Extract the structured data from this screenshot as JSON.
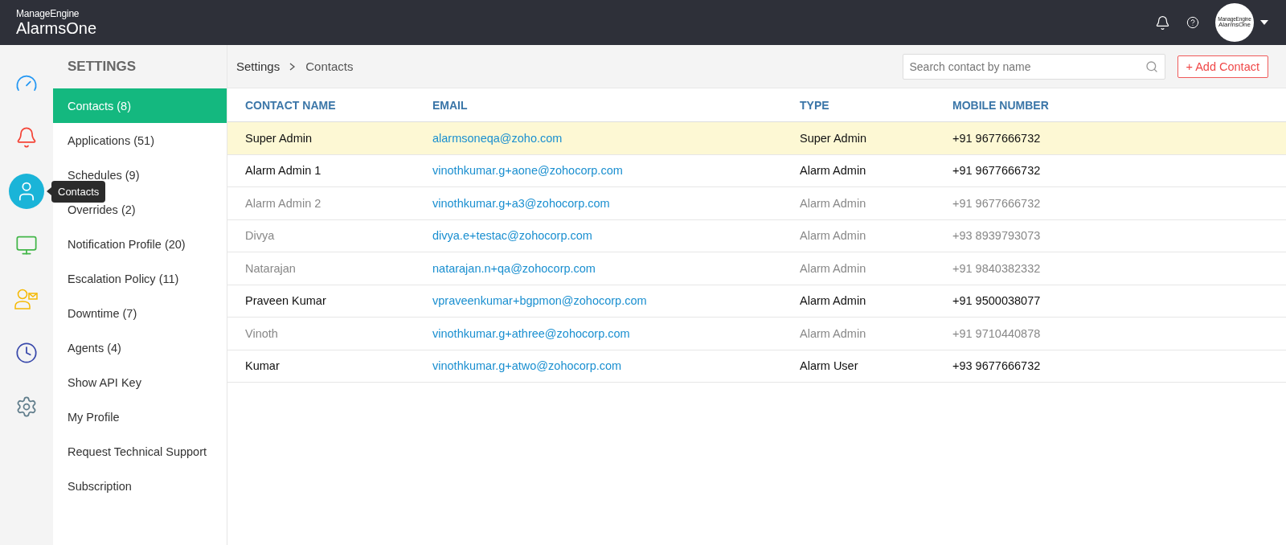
{
  "header": {
    "brand": "ManageEngine",
    "product": "AlarmsOne",
    "avatar_logo": {
      "brand": "ManageEngine",
      "product": "AlarmsOne"
    }
  },
  "rail": [
    {
      "kind": "dashboard",
      "selected": false
    },
    {
      "kind": "alarms",
      "selected": false
    },
    {
      "kind": "contacts",
      "selected": true,
      "tooltip": "Contacts"
    },
    {
      "kind": "monitor",
      "selected": false
    },
    {
      "kind": "oncall",
      "selected": false
    },
    {
      "kind": "schedule",
      "selected": false
    },
    {
      "kind": "settings",
      "selected": false
    }
  ],
  "sidebar": {
    "title": "SETTINGS",
    "items": [
      {
        "label": "Contacts (8)",
        "selected": true
      },
      {
        "label": "Applications (51)",
        "selected": false
      },
      {
        "label": "Schedules (9)",
        "selected": false
      },
      {
        "label": "Overrides (2)",
        "selected": false
      },
      {
        "label": "Notification Profile (20)",
        "selected": false
      },
      {
        "label": "Escalation Policy (11)",
        "selected": false
      },
      {
        "label": "Downtime (7)",
        "selected": false
      },
      {
        "label": "Agents (4)",
        "selected": false
      },
      {
        "label": "Show API Key",
        "selected": false
      },
      {
        "label": "My Profile",
        "selected": false
      },
      {
        "label": "Request Technical Support",
        "selected": false
      },
      {
        "label": "Subscription",
        "selected": false
      }
    ]
  },
  "breadcrumb": [
    "Settings",
    "Contacts"
  ],
  "search": {
    "placeholder": "Search contact by name"
  },
  "add_button": "+ Add Contact",
  "table": {
    "columns": [
      "CONTACT NAME",
      "EMAIL",
      "TYPE",
      "MOBILE NUMBER"
    ],
    "rows": [
      {
        "name": "Super Admin",
        "email": "alarmsoneqa@zoho.com",
        "type": "Super Admin",
        "mobile": "+91 9677666732",
        "selected": true,
        "disabled": false
      },
      {
        "name": "Alarm Admin 1",
        "email": "vinothkumar.g+aone@zohocorp.com",
        "type": "Alarm Admin",
        "mobile": "+91 9677666732",
        "selected": false,
        "disabled": false
      },
      {
        "name": "Alarm Admin 2",
        "email": "vinothkumar.g+a3@zohocorp.com",
        "type": "Alarm Admin",
        "mobile": "+91 9677666732",
        "selected": false,
        "disabled": true
      },
      {
        "name": "Divya",
        "email": "divya.e+testac@zohocorp.com",
        "type": "Alarm Admin",
        "mobile": "+93 8939793073",
        "selected": false,
        "disabled": true
      },
      {
        "name": "Natarajan",
        "email": "natarajan.n+qa@zohocorp.com",
        "type": "Alarm Admin",
        "mobile": "+91 9840382332",
        "selected": false,
        "disabled": true
      },
      {
        "name": "Praveen Kumar",
        "email": "vpraveenkumar+bgpmon@zohocorp.com",
        "type": "Alarm Admin",
        "mobile": "+91 9500038077",
        "selected": false,
        "disabled": false
      },
      {
        "name": "Vinoth",
        "email": "vinothkumar.g+athree@zohocorp.com",
        "type": "Alarm Admin",
        "mobile": "+91 9710440878",
        "selected": false,
        "disabled": true
      },
      {
        "name": "Kumar",
        "email": "vinothkumar.g+atwo@zohocorp.com",
        "type": "Alarm User",
        "mobile": "+93 9677666732",
        "selected": false,
        "disabled": false
      }
    ]
  }
}
